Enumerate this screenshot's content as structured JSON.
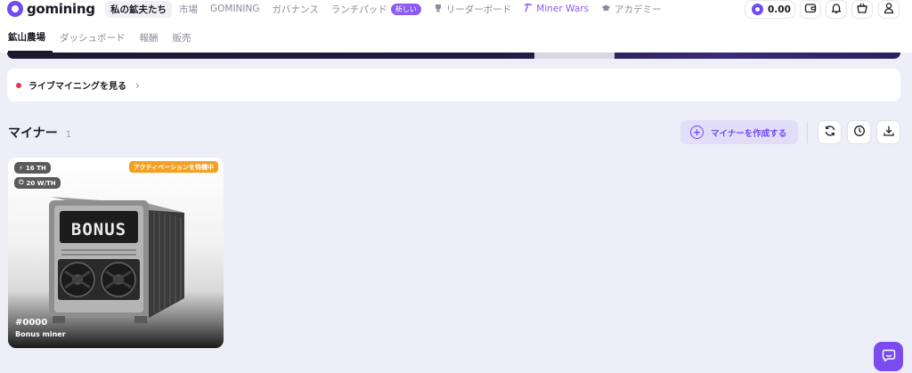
{
  "brand": {
    "name": "gomining"
  },
  "nav": {
    "items": [
      {
        "label": "私の鉱夫たち",
        "active": true
      },
      {
        "label": "市場"
      },
      {
        "label": "GOMINING"
      },
      {
        "label": "ガバナンス"
      },
      {
        "label": "ランチパッド",
        "badge": "新しい"
      },
      {
        "label": "リーダーボード",
        "icon": "trophy-icon"
      },
      {
        "label": "Miner Wars",
        "icon": "pickaxe-icon"
      },
      {
        "label": "アカデミー",
        "icon": "graduation-cap-icon"
      }
    ]
  },
  "header": {
    "balance": "0.00",
    "icons": [
      "wallet-icon",
      "bell-icon",
      "shopping-basket-icon",
      "user-icon"
    ]
  },
  "subtabs": [
    "鉱山農場",
    "ダッシュボード",
    "報酬",
    "販売"
  ],
  "live": {
    "label": "ライブマイニングを見る"
  },
  "section": {
    "title": "マイナー",
    "count": "1",
    "create_label": "マイナーを作成する"
  },
  "actions": [
    "refresh-icon",
    "clock-icon",
    "download-icon"
  ],
  "miner": {
    "hashrate": "16 TH",
    "efficiency": "20 W/TH",
    "status": "アクティベーションを待機中",
    "screen_text": "BONUS",
    "id": "#0000",
    "name": "Bonus miner"
  },
  "colors": {
    "accent": "#6e4cf0",
    "purple_link": "#8a5cf5",
    "status_orange": "#f5a020",
    "live_dot": "#e8325a"
  }
}
